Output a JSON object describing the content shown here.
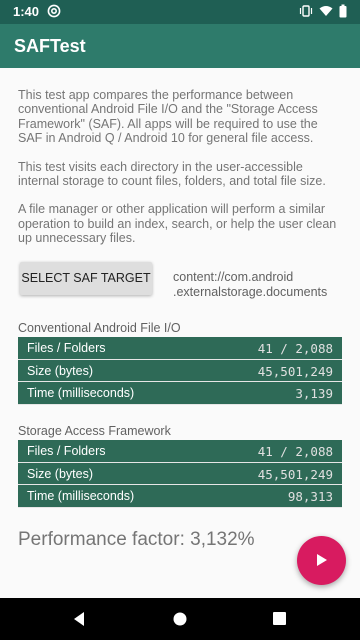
{
  "status_bar": {
    "time": "1:40"
  },
  "app_bar": {
    "title": "SAFTest"
  },
  "intro": {
    "p1": "This test app compares the performance between conventional Android File I/O and the \"Storage Access Framework\" (SAF). All apps will be required to use the SAF in Android Q / Android 10 for general file access.",
    "p2": "This test visits each directory in the user-accessible internal storage to count files, folders, and total file size.",
    "p3": "A file manager or other application will perform a similar operation to build an index, search, or help the user clean up unnecessary files."
  },
  "select_button": {
    "label": "SELECT SAF TARGET"
  },
  "saf_target": {
    "line1": "content://com.android",
    "line2": ".externalstorage.documents"
  },
  "conventional": {
    "label": "Conventional Android File I/O",
    "rows": [
      {
        "key": "Files / Folders",
        "value": "41 / 2,088"
      },
      {
        "key": "Size (bytes)",
        "value": "45,501,249"
      },
      {
        "key": "Time (milliseconds)",
        "value": "3,139"
      }
    ]
  },
  "saf": {
    "label": "Storage Access Framework",
    "rows": [
      {
        "key": "Files / Folders",
        "value": "41 / 2,088"
      },
      {
        "key": "Size (bytes)",
        "value": "45,501,249"
      },
      {
        "key": "Time (milliseconds)",
        "value": "98,313"
      }
    ]
  },
  "performance": {
    "text": "Performance factor: 3,132%"
  },
  "colors": {
    "app_bar": "#2e7b6b",
    "status_bar": "#1f5f54",
    "row_bg": "#2e6a57",
    "fab": "#d81b60"
  },
  "icons": [
    "at-icon",
    "vibrate-icon",
    "wifi-icon",
    "battery-icon",
    "play-icon",
    "back-icon",
    "home-icon",
    "recents-icon"
  ]
}
